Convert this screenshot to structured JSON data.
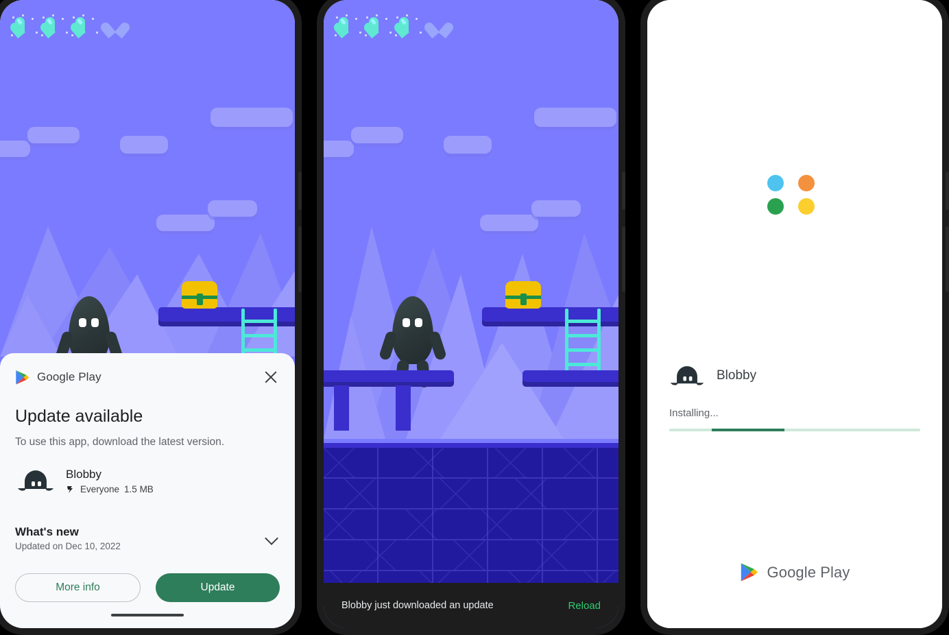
{
  "phone1": {
    "name": "phone-update-dialog",
    "game": {
      "hearts": [
        {
          "state": "full"
        },
        {
          "state": "full"
        },
        {
          "state": "full"
        },
        {
          "state": "empty"
        }
      ],
      "character": "blobby-character",
      "chest": "treasure-chest",
      "ladder": "ladder"
    },
    "dialog": {
      "brand": "Google Play",
      "close_label": "Close",
      "title": "Update available",
      "subtitle": "To use this app, download the latest version.",
      "app": {
        "name": "Blobby",
        "rating": "Everyone",
        "size": "1.5 MB"
      },
      "whats_new": {
        "title": "What's new",
        "date": "Updated on Dec 10, 2022"
      },
      "buttons": {
        "secondary": "More info",
        "primary": "Update"
      }
    }
  },
  "phone2": {
    "name": "phone-snackbar",
    "game": {
      "hearts": [
        {
          "state": "full"
        },
        {
          "state": "full"
        },
        {
          "state": "full"
        },
        {
          "state": "empty"
        }
      ]
    },
    "snackbar": {
      "message": "Blobby just downloaded an update",
      "action": "Reload"
    }
  },
  "phone3": {
    "name": "phone-installing",
    "splash": {
      "dots": [
        {
          "name": "blue-dot",
          "color": "#4ec3f0"
        },
        {
          "name": "orange-dot",
          "color": "#f3913e"
        },
        {
          "name": "green-dot",
          "color": "#2aa14f"
        },
        {
          "name": "yellow-dot",
          "color": "#fcce2e"
        }
      ],
      "app_name": "Blobby",
      "status": "Installing...",
      "progress": {
        "start_pct": 17,
        "end_pct": 46
      },
      "brand": "Google Play"
    }
  },
  "colors": {
    "accent_green": "#2e7d5b",
    "snackbar_action": "#2ecc71",
    "sky": "#7b7bff",
    "platform": "#3a2fcc",
    "ground": "#221a9e",
    "ladder": "#4de8d8",
    "chest_gold": "#f2c200",
    "chest_green": "#1b8f4a",
    "heart_full": "#5fe8d2",
    "heart_empty": "#9aa6fb"
  }
}
